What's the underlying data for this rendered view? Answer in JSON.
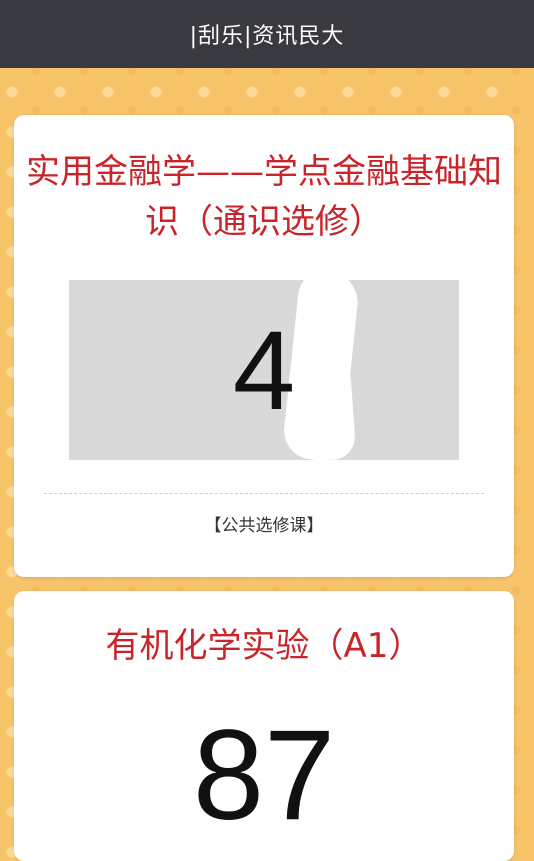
{
  "header": {
    "title": "|刮乐|资讯民大"
  },
  "courses": [
    {
      "title": "实用金融学——学点金融基础知识（通识选修）",
      "score": "4",
      "category": "【公共选修课】"
    },
    {
      "title": "有机化学实验（A1）",
      "score": "87"
    }
  ],
  "colors": {
    "header_bg": "#393a3f",
    "page_bg": "#f7c46a",
    "title_red": "#c8242a"
  }
}
